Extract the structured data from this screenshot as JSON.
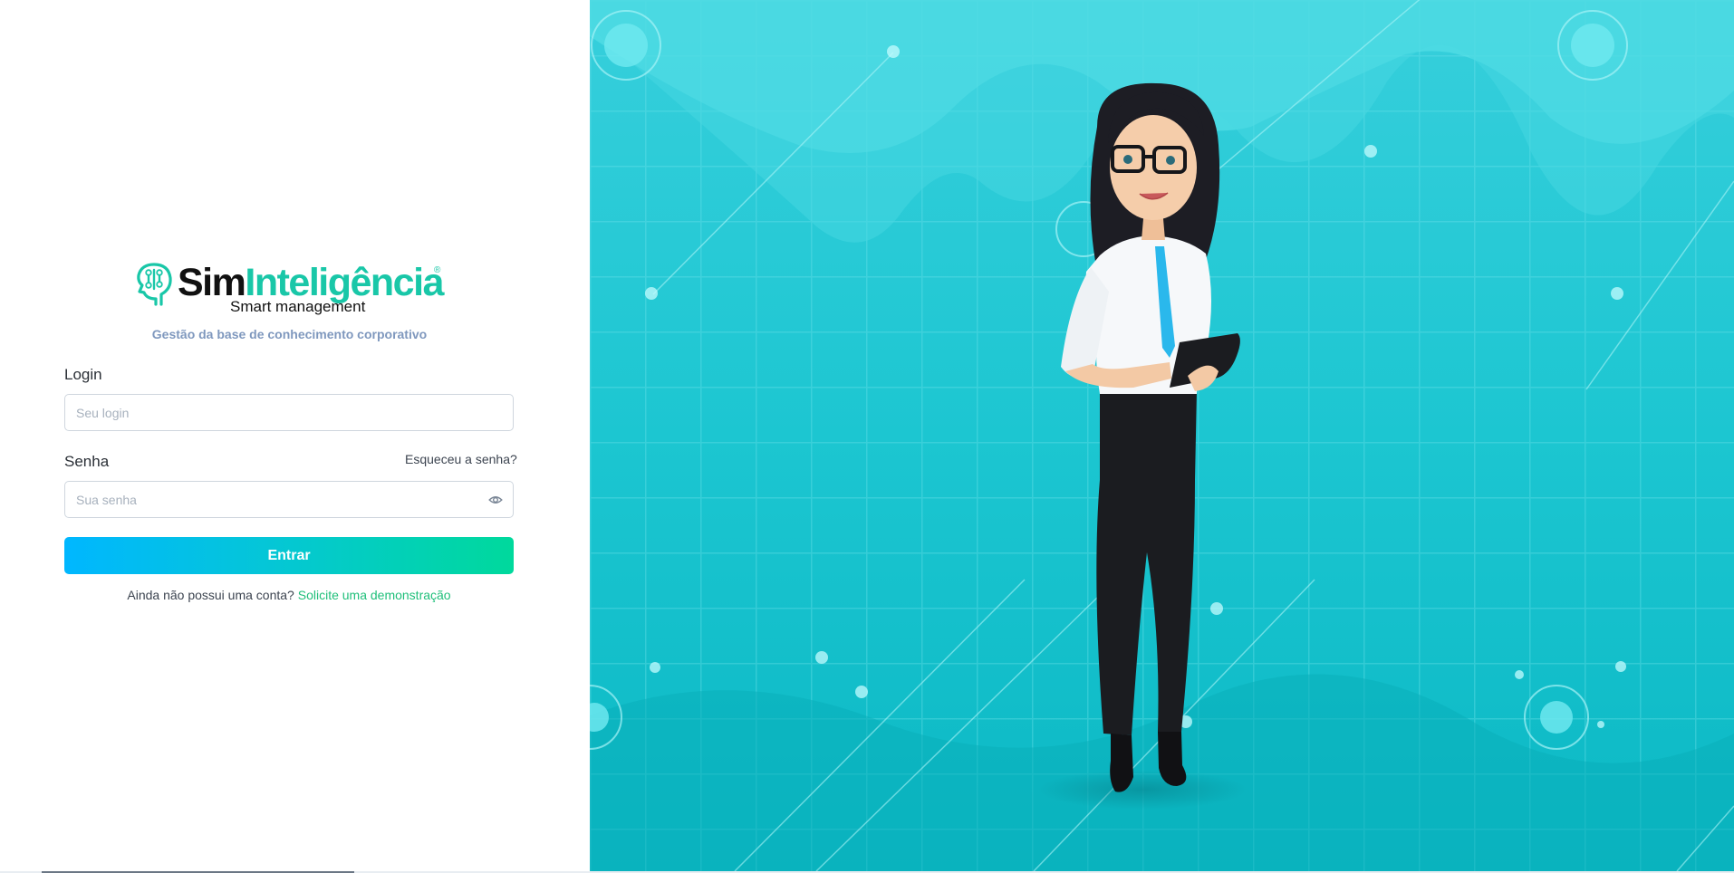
{
  "brand": {
    "name_part1": "Sim",
    "name_part2": "Inteligência",
    "registered": "®",
    "subtitle": "Smart management",
    "tagline": "Gestão da base de conhecimento corporativo"
  },
  "form": {
    "login_label": "Login",
    "login_placeholder": "Seu login",
    "password_label": "Senha",
    "password_placeholder": "Sua senha",
    "forgot_link": "Esqueceu a senha?",
    "submit_label": "Entrar",
    "no_account_text": "Ainda não possui uma conta?",
    "demo_link": "Solicite uma demonstração"
  },
  "icons": {
    "logo": "brain-circuit-head-icon",
    "toggle_password": "eye-icon"
  },
  "colors": {
    "brand_teal": "#19c7a8",
    "button_gradient_start": "#00b7ff",
    "button_gradient_end": "#00d99c",
    "panel_background": "#13c3cc",
    "link_green": "#1fbf7a",
    "tagline": "#7f98be"
  }
}
